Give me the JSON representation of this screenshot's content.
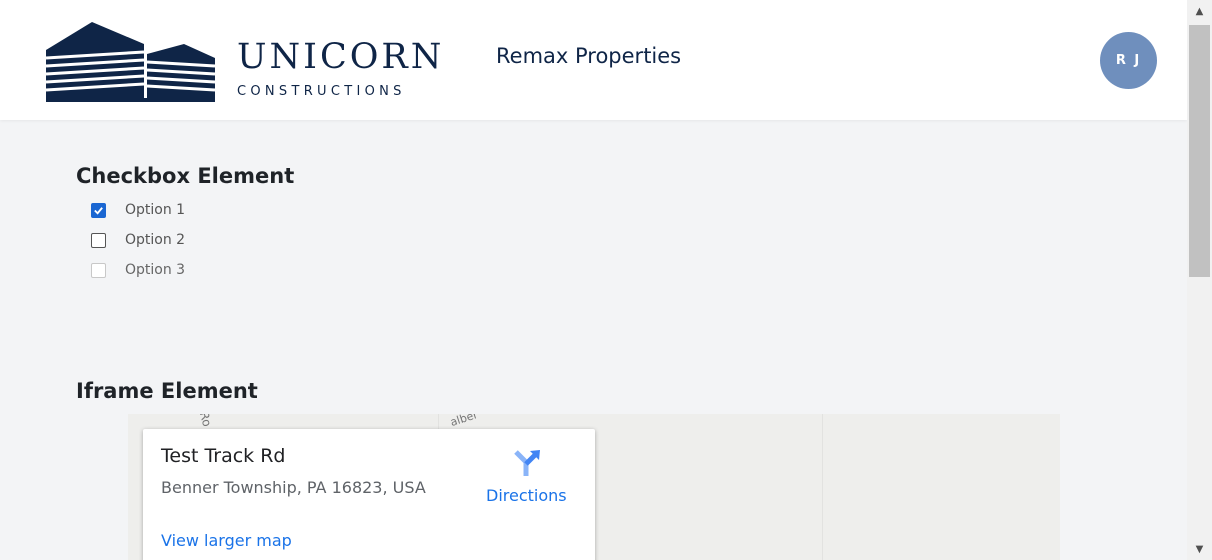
{
  "header": {
    "brand_name": "UNICORN",
    "brand_sub": "CONSTRUCTIONS",
    "site_title": "Remax Properties",
    "avatar_initials": "R J",
    "brand_color": "#0f2547",
    "avatar_color": "#6f8fbd"
  },
  "checkbox_section": {
    "title": "Checkbox Element",
    "options": [
      {
        "label": "Option 1",
        "checked": true,
        "disabled": false
      },
      {
        "label": "Option 2",
        "checked": false,
        "disabled": false
      },
      {
        "label": "Option 3",
        "checked": false,
        "disabled": true
      }
    ]
  },
  "iframe_section": {
    "title": "Iframe Element",
    "map": {
      "road_label_1": "Ro",
      "road_label_2": "alber",
      "place_name": "Test Track Rd",
      "place_address": "Benner Township, PA 16823, USA",
      "directions_label": "Directions",
      "larger_map_link": "View larger map",
      "link_color": "#1a73e8"
    }
  },
  "scrollbar": {
    "up_icon": "triangle-up-icon",
    "down_icon": "triangle-down-icon"
  }
}
